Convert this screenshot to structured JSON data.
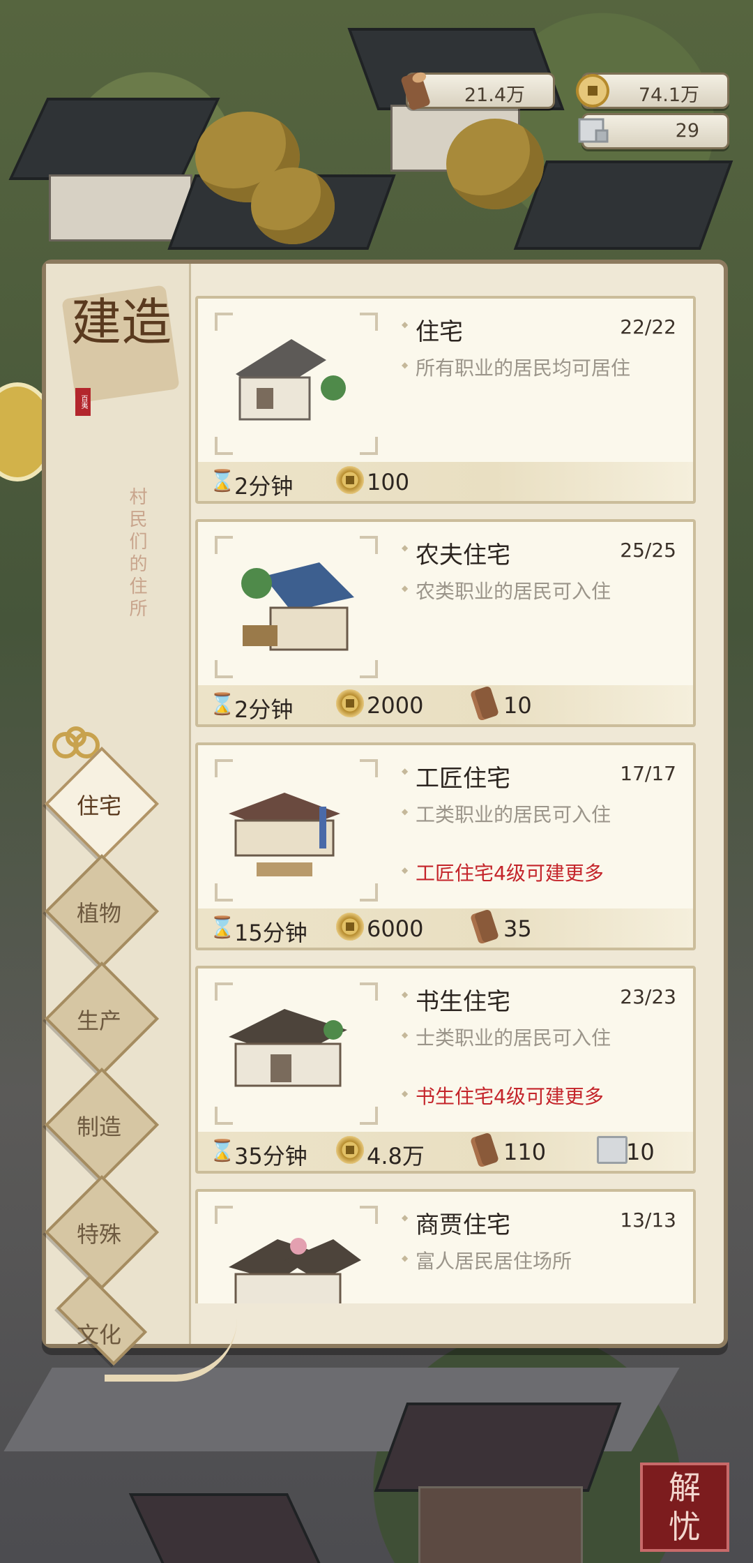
{
  "resources": {
    "wood": "21.4万",
    "coins": "74.1万",
    "stone": "29"
  },
  "panel": {
    "title": "建造",
    "seal": "百夷",
    "subtitle": "村民们的住所"
  },
  "tabs": [
    {
      "label": "住宅",
      "active": true
    },
    {
      "label": "植物",
      "active": false
    },
    {
      "label": "生产",
      "active": false
    },
    {
      "label": "制造",
      "active": false
    },
    {
      "label": "特殊",
      "active": false
    },
    {
      "label": "文化",
      "active": false
    }
  ],
  "buildings": [
    {
      "name": "住宅",
      "count": "22/22",
      "desc": "所有职业的居民均可居住",
      "warn": "",
      "time": "2分钟",
      "coins": "100",
      "wood": "",
      "stone": ""
    },
    {
      "name": "农夫住宅",
      "count": "25/25",
      "desc": "农类职业的居民可入住",
      "warn": "",
      "time": "2分钟",
      "coins": "2000",
      "wood": "10",
      "stone": ""
    },
    {
      "name": "工匠住宅",
      "count": "17/17",
      "desc": "工类职业的居民可入住",
      "warn": "工匠住宅4级可建更多",
      "time": "15分钟",
      "coins": "6000",
      "wood": "35",
      "stone": ""
    },
    {
      "name": "书生住宅",
      "count": "23/23",
      "desc": "士类职业的居民可入住",
      "warn": "书生住宅4级可建更多",
      "time": "35分钟",
      "coins": "4.8万",
      "wood": "110",
      "stone": "10"
    },
    {
      "name": "商贾住宅",
      "count": "13/13",
      "desc": "富人居民居住场所",
      "warn": "",
      "time": "",
      "coins": "",
      "wood": "",
      "stone": ""
    }
  ],
  "stamp": "解忧"
}
